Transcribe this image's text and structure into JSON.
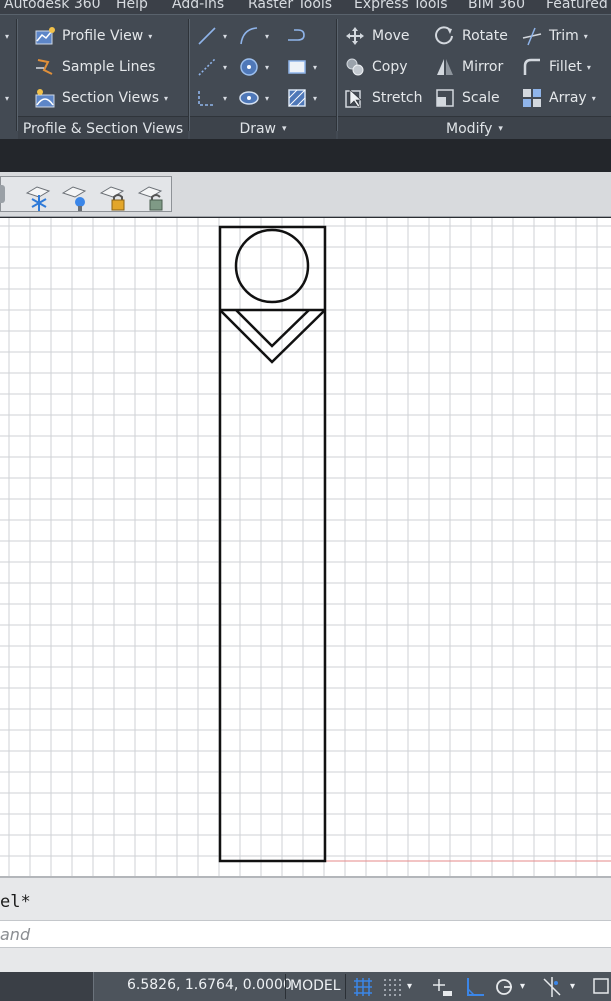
{
  "menu_tabs": [
    "Autodesk 360",
    "Help",
    "Add-ins",
    "Raster Tools",
    "Express Tools",
    "BIM 360",
    "Featured Apps"
  ],
  "ribbon": {
    "profile_panel": {
      "title": "Profile & Section Views",
      "items": [
        {
          "label": "Profile View",
          "icon": "profile-view-icon"
        },
        {
          "label": "Sample Lines",
          "icon": "sample-lines-icon"
        },
        {
          "label": "Section Views",
          "icon": "section-views-icon"
        }
      ]
    },
    "draw_panel": {
      "title": "Draw",
      "tools": [
        "line-icon",
        "arc-icon",
        "polyline-icon",
        "construction-line-icon",
        "circle-icon",
        "rectangle-icon",
        "polyline-dashed-icon",
        "ellipse-icon",
        "hatch-icon"
      ]
    },
    "modify_panel": {
      "title": "Modify",
      "items": [
        {
          "label": "Move",
          "icon": "move-icon"
        },
        {
          "label": "Rotate",
          "icon": "rotate-icon"
        },
        {
          "label": "Trim",
          "icon": "trim-icon"
        },
        {
          "label": "Copy",
          "icon": "copy-icon"
        },
        {
          "label": "Mirror",
          "icon": "mirror-icon"
        },
        {
          "label": "Fillet",
          "icon": "fillet-icon"
        },
        {
          "label": "Stretch",
          "icon": "stretch-icon"
        },
        {
          "label": "Scale",
          "icon": "scale-icon"
        },
        {
          "label": "Array",
          "icon": "array-icon"
        }
      ]
    }
  },
  "layer_toolbar": [
    "layer-freeze-icon",
    "layer-isolate-icon",
    "layer-lock-icon",
    "layer-unlock-icon"
  ],
  "command": {
    "history": "el*",
    "placeholder": "and"
  },
  "status": {
    "coordinates": "6.5826, 1.6764, 0.0000",
    "space": "MODEL"
  },
  "colors": {
    "ribbon_bg": "#434a53",
    "accent_blue": "#3b86e8",
    "grid_line": "#cfd2d6",
    "drawing_stroke": "#111111"
  }
}
